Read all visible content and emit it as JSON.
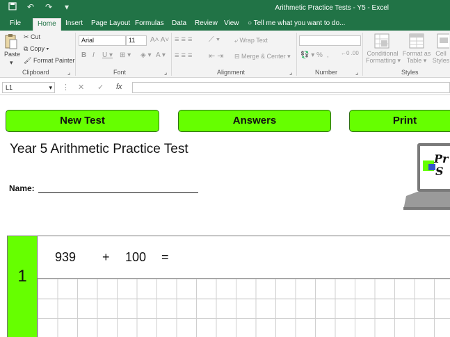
{
  "window": {
    "title": "Arithmetic Practice Tests - Y5 - Excel",
    "qat": {
      "save_icon": "save-icon",
      "undo_icon": "undo-icon",
      "redo_icon": "redo-icon"
    }
  },
  "tabs": [
    "File",
    "Home",
    "Insert",
    "Page Layout",
    "Formulas",
    "Data",
    "Review",
    "View"
  ],
  "tell_me": "Tell me what you want to do...",
  "ribbon": {
    "clipboard": {
      "paste": "Paste",
      "cut": "Cut",
      "copy": "Copy",
      "format_painter": "Format Painter",
      "label": "Clipboard"
    },
    "font": {
      "name": "Arial",
      "size": "11",
      "label": "Font"
    },
    "alignment": {
      "wrap_text": "Wrap Text",
      "merge_center": "Merge & Center",
      "label": "Alignment"
    },
    "number": {
      "format": "",
      "percent": "%",
      "label": "Number"
    },
    "styles": {
      "conditional": "Conditional",
      "conditional2": "Formatting",
      "format_as": "Format as",
      "table": "Table",
      "cell": "Cell",
      "styles2": "Styles",
      "label": "Styles"
    }
  },
  "formula_bar": {
    "name_box": "L1",
    "fx": "fx",
    "value": ""
  },
  "sheet": {
    "buttons": {
      "new_test": "New Test",
      "answers": "Answers",
      "print": "Print"
    },
    "title": "Year 5 Arithmetic Practice Test",
    "name_label": "Name:",
    "question": {
      "number": "1",
      "a": "939",
      "op": "+",
      "b": "100",
      "eq": "="
    }
  },
  "colors": {
    "excel_green": "#217346",
    "button_green": "#66ff00"
  }
}
